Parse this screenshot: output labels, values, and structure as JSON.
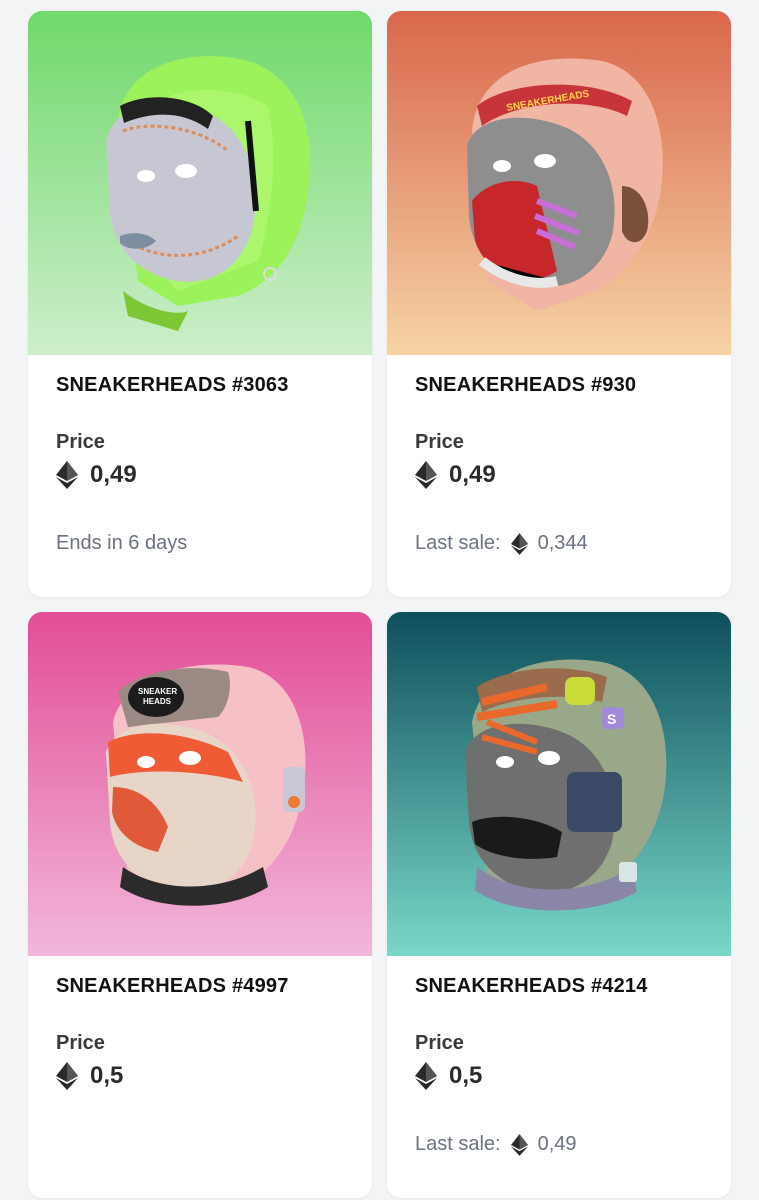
{
  "currency_icon": "ethereum-icon",
  "cards": [
    {
      "title": "SNEAKERHEADS #3063",
      "price_label": "Price",
      "price": "0,49",
      "meta_text": "Ends in 6 days",
      "last_sale_label": "",
      "last_sale_value": "",
      "background": [
        "#6fd96a",
        "#cdeecb"
      ]
    },
    {
      "title": "SNEAKERHEADS #930",
      "price_label": "Price",
      "price": "0,49",
      "meta_text": "",
      "last_sale_label": "Last sale:",
      "last_sale_value": "0,344",
      "background": [
        "#d9674b",
        "#f6d3a4"
      ]
    },
    {
      "title": "SNEAKERHEADS #4997",
      "price_label": "Price",
      "price": "0,5",
      "meta_text": "",
      "last_sale_label": "",
      "last_sale_value": "",
      "background": [
        "#e24d97",
        "#f2b7da"
      ]
    },
    {
      "title": "SNEAKERHEADS #4214",
      "price_label": "Price",
      "price": "0,5",
      "meta_text": "",
      "last_sale_label": "Last sale:",
      "last_sale_value": "0,49",
      "background": [
        "#0e4f5c",
        "#79d8c9"
      ]
    }
  ]
}
